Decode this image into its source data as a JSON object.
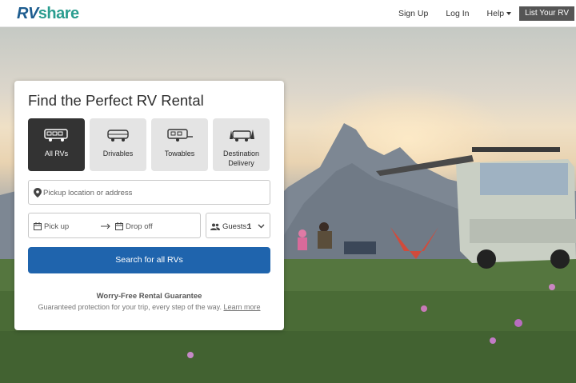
{
  "nav": {
    "logo_rv": "RV",
    "logo_share": "share",
    "sign_up": "Sign Up",
    "log_in": "Log In",
    "help": "Help",
    "list_rv": "List Your RV"
  },
  "search_card": {
    "title": "Find the Perfect RV Rental",
    "types": [
      {
        "label": "All RVs",
        "icon": "all-rvs-icon",
        "active": true
      },
      {
        "label": "Drivables",
        "icon": "drivable-rv-icon",
        "active": false
      },
      {
        "label": "Towables",
        "icon": "towable-trailer-icon",
        "active": false
      },
      {
        "label": "Destination Delivery",
        "icon": "delivery-icon",
        "active": false
      }
    ],
    "location_placeholder": "Pickup location or address",
    "pickup_label": "Pick up",
    "dropoff_label": "Drop off",
    "guests_label": "Guests:",
    "guests_count": "1",
    "search_button": "Search for all RVs",
    "guarantee_title": "Worry-Free Rental Guarantee",
    "guarantee_text": "Guaranteed protection for your trip, every step of the way.",
    "learn_more": "Learn more"
  },
  "colors": {
    "brand_blue": "#1d5c8f",
    "brand_green": "#2a9d8f",
    "primary_button": "#1f64ad",
    "active_type": "#333333"
  }
}
